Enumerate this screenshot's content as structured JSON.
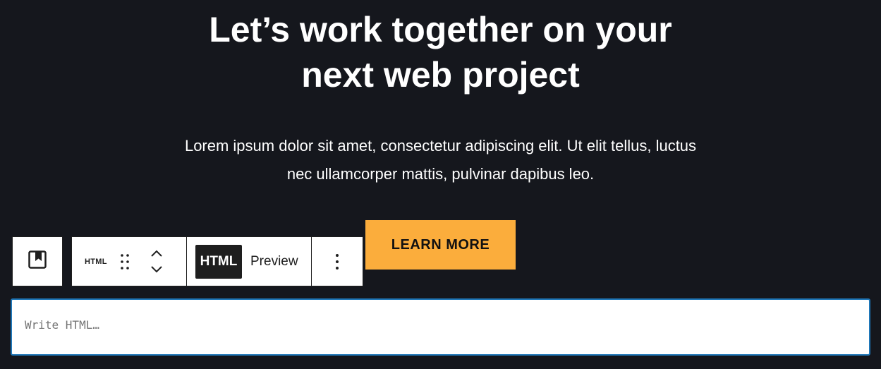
{
  "hero": {
    "heading_line1": "Let’s work together on your",
    "heading_line2": "next web project",
    "paragraph_line1": "Lorem ipsum dolor sit amet, consectetur adipiscing elit. Ut elit tellus, luctus",
    "paragraph_line2": "nec ullamcorper mattis, pulvinar dapibus leo.",
    "cta_label": "LEARN MORE"
  },
  "toolbar": {
    "parent_icon": "bookmark-square-icon",
    "block_type_label": "HTML",
    "drag_icon": "drag-handle-icon",
    "move_up_icon": "chevron-up-icon",
    "move_down_icon": "chevron-down-icon",
    "tabs": [
      {
        "label": "HTML",
        "active": true
      },
      {
        "label": "Preview",
        "active": false
      }
    ],
    "more_icon": "more-vertical-icon"
  },
  "editor": {
    "value": "",
    "placeholder": "Write HTML…"
  },
  "colors": {
    "background": "#15171d",
    "text": "#ffffff",
    "accent": "#fbad3c",
    "editor_border": "#1f77b8",
    "toolbar_active": "#1e1e1e"
  }
}
